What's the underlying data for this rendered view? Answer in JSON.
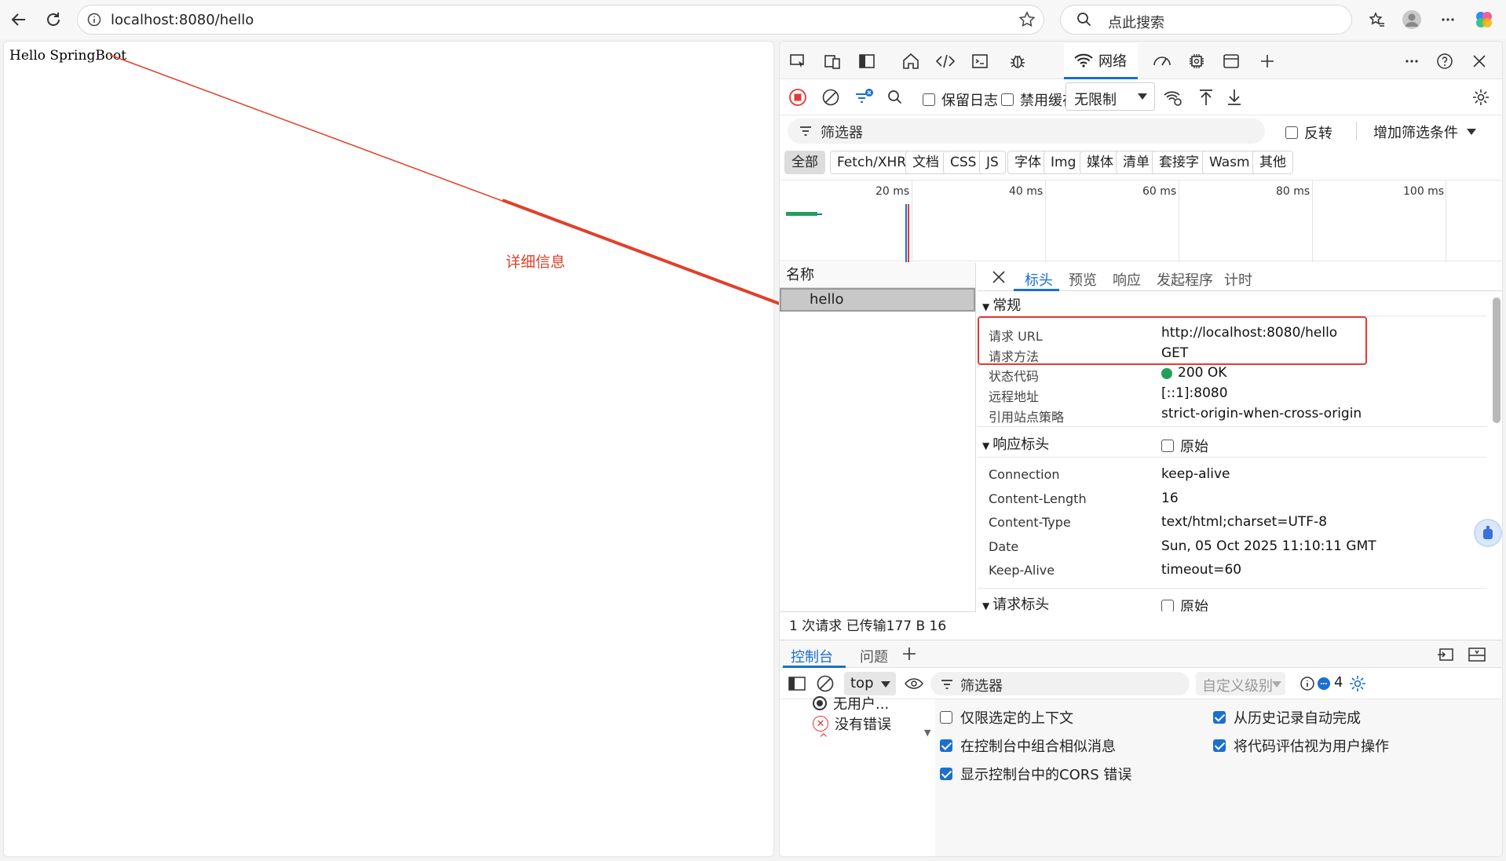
{
  "browser": {
    "url": "localhost:8080/hello",
    "search_placeholder": "点此搜索"
  },
  "page": {
    "body_text": "Hello SpringBoot"
  },
  "annotation": {
    "label": "详细信息",
    "color": "#e0402a"
  },
  "devtools": {
    "network_tab_label": "网络",
    "toolbar": {
      "preserve_log": "保留日志",
      "disable_cache": "禁用缓存",
      "throttle": "无限制"
    },
    "filter": {
      "placeholder": "筛选器",
      "invert": "反转",
      "add_filter": "增加筛选条件"
    },
    "types": [
      "全部",
      "Fetch/XHR",
      "文档",
      "CSS",
      "JS",
      "字体",
      "Img",
      "媒体",
      "清单",
      "套接字",
      "Wasm",
      "其他"
    ],
    "timeline_ticks": [
      "20 ms",
      "40 ms",
      "60 ms",
      "80 ms",
      "100 ms"
    ],
    "requests": {
      "column_name": "名称",
      "rows": [
        "hello"
      ],
      "summary": "1 次请求   已传输177 B   16"
    },
    "detail_tabs": [
      "标头",
      "预览",
      "响应",
      "发起程序",
      "计时"
    ],
    "general": {
      "title": "常规",
      "rows": [
        {
          "key": "请求 URL",
          "value": "http://localhost:8080/hello"
        },
        {
          "key": "请求方法",
          "value": "GET"
        },
        {
          "key": "状态代码",
          "value": "200 OK"
        },
        {
          "key": "远程地址",
          "value": "[::1]:8080"
        },
        {
          "key": "引用站点策略",
          "value": "strict-origin-when-cross-origin"
        }
      ]
    },
    "response_headers": {
      "title": "响应标头",
      "raw_label": "原始",
      "rows": [
        {
          "key": "Connection",
          "value": "keep-alive"
        },
        {
          "key": "Content-Length",
          "value": "16"
        },
        {
          "key": "Content-Type",
          "value": "text/html;charset=UTF-8"
        },
        {
          "key": "Date",
          "value": "Sun, 05 Oct 2025 11:10:11 GMT"
        },
        {
          "key": "Keep-Alive",
          "value": "timeout=60"
        }
      ]
    },
    "request_headers": {
      "title": "请求标头",
      "raw_label": "原始"
    },
    "drawer": {
      "tabs": [
        "控制台",
        "问题"
      ],
      "context": "top",
      "filter_placeholder": "筛选器",
      "levels": "自定义级别",
      "issue_count": "4",
      "sidebar_items": [
        "无用户...",
        "没有错误"
      ],
      "options_left": [
        "仅限选定的上下文",
        "在控制台中组合相似消息",
        "显示控制台中的CORS 错误"
      ],
      "options_right": [
        "从历史记录自动完成",
        "将代码评估视为用户操作"
      ]
    }
  }
}
